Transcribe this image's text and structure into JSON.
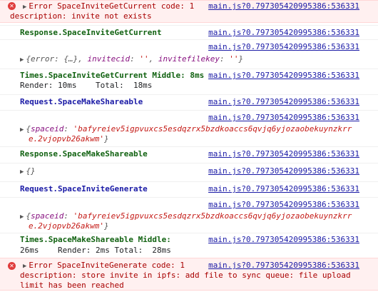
{
  "entries": [
    {
      "line1": "Error SpaceInviteGetCurrent code: 1",
      "line2": "description: invite not exists",
      "source": "main.js?0.797305420995386:536331"
    },
    {
      "label": "Response.SpaceInviteGetCurrent",
      "source": "main.js?0.797305420995386:536331"
    },
    {
      "source": "main.js?0.797305420995386:536331",
      "obj_open": "{error: {…}, ",
      "obj_k1": "invitecid",
      "obj_v1": "''",
      "obj_sep": ", ",
      "obj_k2": "invitefilekey",
      "obj_v2": "''",
      "obj_close": "}"
    },
    {
      "line1": "Times.SpaceInviteGetCurrent Middle: 8ms",
      "line2": "Render: 10ms    Total:  18ms",
      "source": "main.js?0.797305420995386:536331"
    },
    {
      "label": "Request.SpaceMakeShareable",
      "source": "main.js?0.797305420995386:536331"
    },
    {
      "source": "main.js?0.797305420995386:536331",
      "obj_open": "{",
      "obj_k1": "spaceid",
      "obj_v1": "'bafyreiev5igpvuxcs5esdqzrx5bzdkoaccs6qvjq6yjozaobekuynzkrr",
      "obj_v1b": "e.2vjopvb26akwm'",
      "obj_close": "}"
    },
    {
      "label": "Response.SpaceMakeShareable",
      "source": "main.js?0.797305420995386:536331"
    },
    {
      "obj": "{}",
      "source": "main.js?0.797305420995386:536331"
    },
    {
      "label": "Request.SpaceInviteGenerate",
      "source": "main.js?0.797305420995386:536331"
    },
    {
      "source": "main.js?0.797305420995386:536331",
      "obj_open": "{",
      "obj_k1": "spaceid",
      "obj_v1": "'bafyreiev5igpvuxcs5esdqzrx5bzdkoaccs6qvjq6yjozaobekuynzkrr",
      "obj_v1b": "e.2vjopvb26akwm'",
      "obj_close": "}"
    },
    {
      "line1": "Times.SpaceMakeShareable Middle:",
      "line2": "26ms    Render: 2ms Total:  28ms",
      "source": "main.js?0.797305420995386:536331"
    },
    {
      "line1": "Error SpaceInviteGenerate code: 1",
      "line2": "description: store invite in ipfs: add file to sync queue: file upload",
      "line3": "limit has been reached",
      "source": "main.js?0.797305420995386:536331"
    }
  ],
  "colors": {
    "error_bg": "#fff0f0",
    "error_text": "#a80000",
    "link": "#1a1aa6",
    "response_label": "#116211",
    "request_label": "#1a1aa6"
  }
}
